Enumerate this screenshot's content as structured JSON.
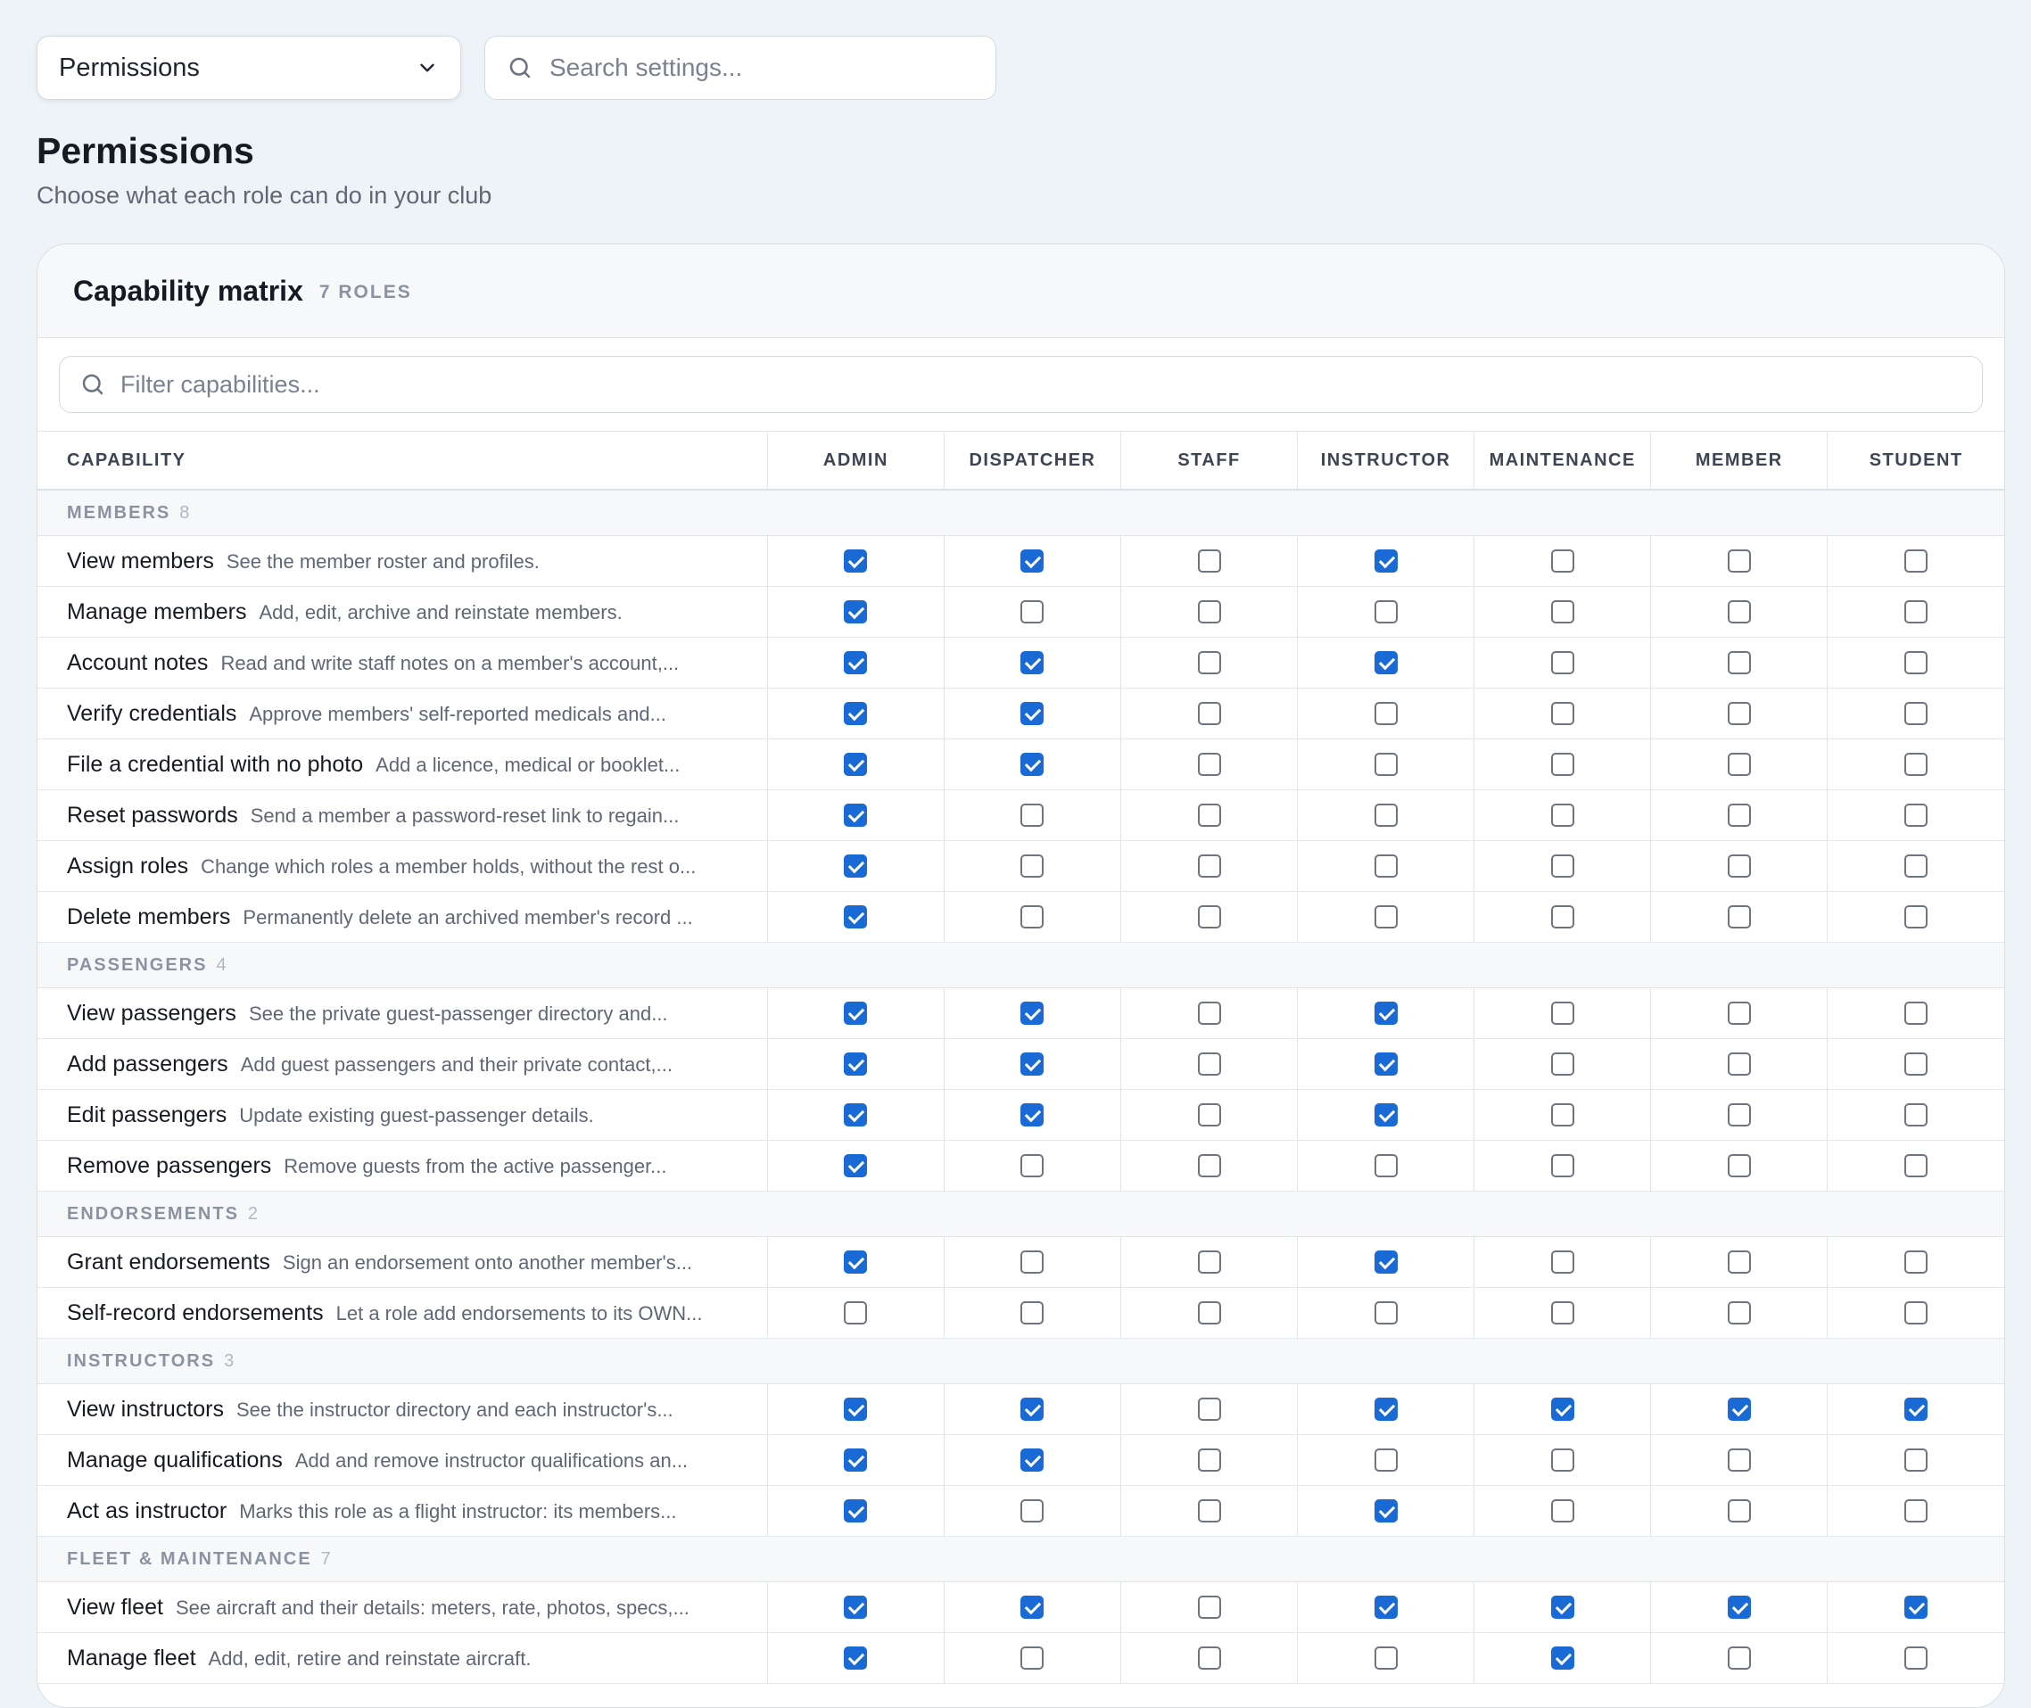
{
  "section_select": {
    "value": "Permissions"
  },
  "settings_search": {
    "placeholder": "Search settings..."
  },
  "page": {
    "title": "Permissions",
    "subtitle": "Choose what each role can do in your club"
  },
  "matrix": {
    "title": "Capability matrix",
    "badge": "7 ROLES",
    "filter_placeholder": "Filter capabilities...",
    "capability_header": "CAPABILITY",
    "roles": [
      "ADMIN",
      "DISPATCHER",
      "STAFF",
      "INSTRUCTOR",
      "MAINTENANCE",
      "MEMBER",
      "STUDENT"
    ],
    "groups": [
      {
        "name": "MEMBERS",
        "count": "8",
        "rows": [
          {
            "name": "View members",
            "desc": "See the member roster and profiles.",
            "checks": [
              true,
              true,
              false,
              true,
              false,
              false,
              false
            ]
          },
          {
            "name": "Manage members",
            "desc": "Add, edit, archive and reinstate members.",
            "checks": [
              true,
              false,
              false,
              false,
              false,
              false,
              false
            ]
          },
          {
            "name": "Account notes",
            "desc": "Read and write staff notes on a member's account,...",
            "checks": [
              true,
              true,
              false,
              true,
              false,
              false,
              false
            ]
          },
          {
            "name": "Verify credentials",
            "desc": "Approve members' self-reported medicals and...",
            "checks": [
              true,
              true,
              false,
              false,
              false,
              false,
              false
            ]
          },
          {
            "name": "File a credential with no photo",
            "desc": "Add a licence, medical or booklet...",
            "checks": [
              true,
              true,
              false,
              false,
              false,
              false,
              false
            ]
          },
          {
            "name": "Reset passwords",
            "desc": "Send a member a password-reset link to regain...",
            "checks": [
              true,
              false,
              false,
              false,
              false,
              false,
              false
            ]
          },
          {
            "name": "Assign roles",
            "desc": "Change which roles a member holds, without the rest o...",
            "checks": [
              true,
              false,
              false,
              false,
              false,
              false,
              false
            ]
          },
          {
            "name": "Delete members",
            "desc": "Permanently delete an archived member's record ...",
            "checks": [
              true,
              false,
              false,
              false,
              false,
              false,
              false
            ]
          }
        ]
      },
      {
        "name": "PASSENGERS",
        "count": "4",
        "rows": [
          {
            "name": "View passengers",
            "desc": "See the private guest-passenger directory and...",
            "checks": [
              true,
              true,
              false,
              true,
              false,
              false,
              false
            ]
          },
          {
            "name": "Add passengers",
            "desc": "Add guest passengers and their private contact,...",
            "checks": [
              true,
              true,
              false,
              true,
              false,
              false,
              false
            ]
          },
          {
            "name": "Edit passengers",
            "desc": "Update existing guest-passenger details.",
            "checks": [
              true,
              true,
              false,
              true,
              false,
              false,
              false
            ]
          },
          {
            "name": "Remove passengers",
            "desc": "Remove guests from the active passenger...",
            "checks": [
              true,
              false,
              false,
              false,
              false,
              false,
              false
            ]
          }
        ]
      },
      {
        "name": "ENDORSEMENTS",
        "count": "2",
        "rows": [
          {
            "name": "Grant endorsements",
            "desc": "Sign an endorsement onto another member's...",
            "checks": [
              true,
              false,
              false,
              true,
              false,
              false,
              false
            ]
          },
          {
            "name": "Self-record endorsements",
            "desc": "Let a role add endorsements to its OWN...",
            "checks": [
              false,
              false,
              false,
              false,
              false,
              false,
              false
            ]
          }
        ]
      },
      {
        "name": "INSTRUCTORS",
        "count": "3",
        "rows": [
          {
            "name": "View instructors",
            "desc": "See the instructor directory and each instructor's...",
            "checks": [
              true,
              true,
              false,
              true,
              true,
              true,
              true
            ]
          },
          {
            "name": "Manage qualifications",
            "desc": "Add and remove instructor qualifications an...",
            "checks": [
              true,
              true,
              false,
              false,
              false,
              false,
              false
            ]
          },
          {
            "name": "Act as instructor",
            "desc": "Marks this role as a flight instructor: its members...",
            "checks": [
              true,
              false,
              false,
              true,
              false,
              false,
              false
            ]
          }
        ]
      },
      {
        "name": "FLEET & MAINTENANCE",
        "count": "7",
        "rows": [
          {
            "name": "View fleet",
            "desc": "See aircraft and their details: meters, rate, photos, specs,...",
            "checks": [
              true,
              true,
              false,
              true,
              true,
              true,
              true
            ]
          },
          {
            "name": "Manage fleet",
            "desc": "Add, edit, retire and reinstate aircraft.",
            "checks": [
              true,
              false,
              false,
              false,
              true,
              false,
              false
            ]
          }
        ]
      }
    ]
  }
}
